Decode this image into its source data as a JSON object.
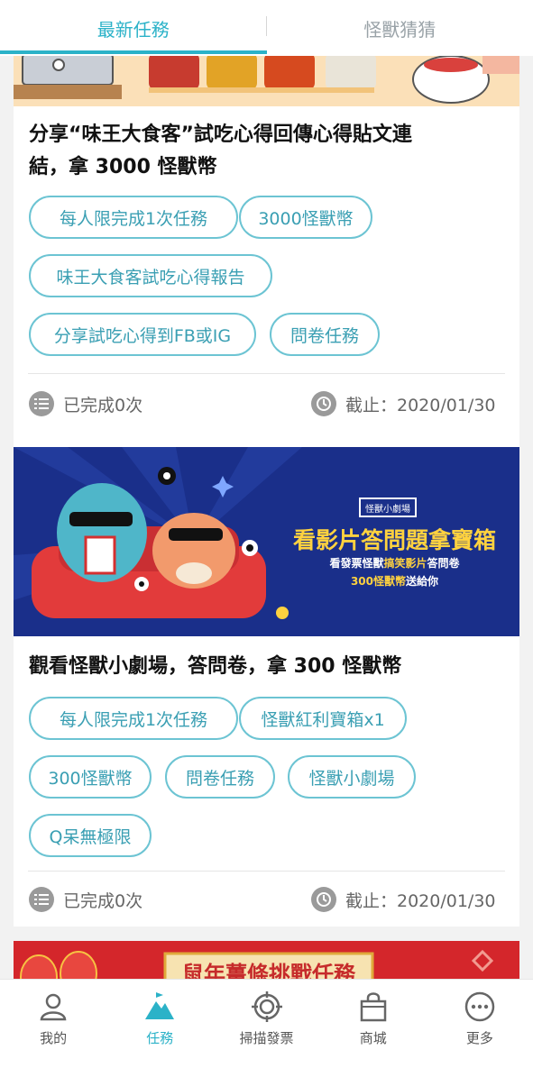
{
  "tabs": [
    {
      "label": "最新任務",
      "active": true
    },
    {
      "label": "怪獸猜猜",
      "active": false
    }
  ],
  "card1": {
    "title_line1": "分享“味王大食客”試吃心得回傳心得貼文連",
    "title_line2": "結，拿 3000 怪獸幣",
    "chips": [
      "每人限完成1次任務",
      "3000怪獸幣",
      "味王大食客試吃心得報告",
      "分享試吃心得到FB或IG",
      "問卷任務"
    ],
    "completed": "已完成0次",
    "deadline": "截止：2020/01/30"
  },
  "card2": {
    "banner": {
      "badge": "怪獸小劇場",
      "headline": "看影片答問題拿寶箱",
      "sub1_a": "看發票怪獸",
      "sub1_b": "搞笑影片",
      "sub1_c": "答問卷",
      "sub2_a": "300怪獸幣",
      "sub2_b": "送給你"
    },
    "title": "觀看怪獸小劇場，答問卷，拿 300 怪獸幣",
    "chips": [
      "每人限完成1次任務",
      "怪獸紅利寶箱x1",
      "300怪獸幣",
      "問卷任務",
      "怪獸小劇場",
      "Q呆無極限"
    ],
    "completed": "已完成0次",
    "deadline": "截止：2020/01/30"
  },
  "card3": {
    "banner_text": "鼠年薑條挑戰任務"
  },
  "bottomnav": [
    {
      "label": "我的",
      "icon": "person-icon",
      "active": false
    },
    {
      "label": "任務",
      "icon": "mountain-flag-icon",
      "active": true
    },
    {
      "label": "掃描發票",
      "icon": "crosshair-icon",
      "active": false
    },
    {
      "label": "商城",
      "icon": "shopping-bag-icon",
      "active": false
    },
    {
      "label": "更多",
      "icon": "more-dots-icon",
      "active": false
    }
  ],
  "colors": {
    "accent": "#2bb2c8",
    "chip_border": "#6cc4d3",
    "banner_blue": "#1a2f8a",
    "banner_yellow": "#ffd23f"
  }
}
